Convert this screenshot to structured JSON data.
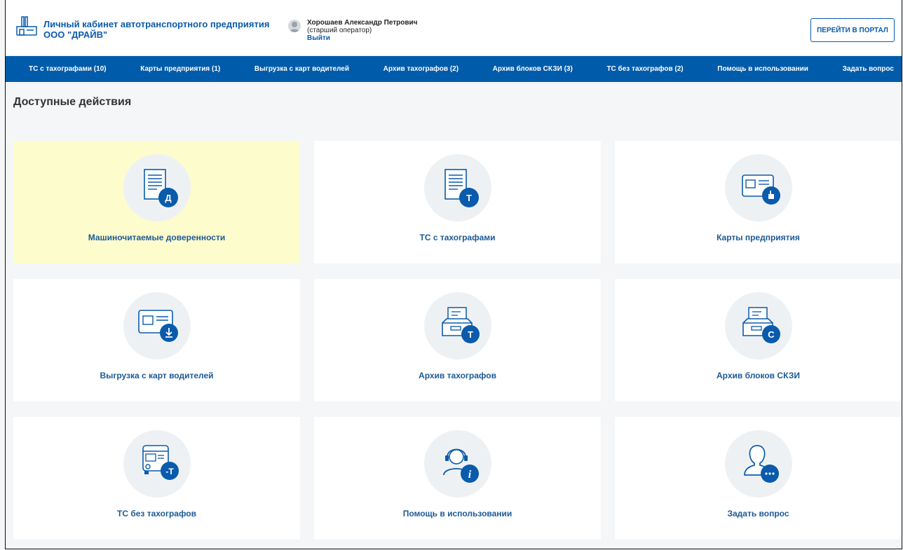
{
  "header": {
    "company_line1": "Личный кабинет автотранспортного предприятия",
    "company_line2": "ООО \"ДРАЙВ\"",
    "user_name": "Хорошаев Александр Петрович",
    "user_role": "(старший оператор)",
    "logout": "Выйти",
    "portal_button": "ПЕРЕЙТИ В ПОРТАЛ"
  },
  "nav": {
    "items": [
      {
        "label": "ТС с тахографами (10)"
      },
      {
        "label": "Карты предприятия (1)"
      },
      {
        "label": "Выгрузка с карт водителей"
      },
      {
        "label": "Архив тахографов (2)"
      },
      {
        "label": "Архив блоков СКЗИ (3)"
      },
      {
        "label": "ТС без тахографов (2)"
      },
      {
        "label": "Помощь в использовании"
      },
      {
        "label": "Задать вопрос"
      }
    ]
  },
  "main": {
    "title": "Доступные действия",
    "cards": [
      {
        "label": "Машиночитаемые доверенности",
        "icon": "document-icon",
        "badge": "Д",
        "highlighted": true
      },
      {
        "label": "ТС с тахографами",
        "icon": "document-icon",
        "badge": "Т"
      },
      {
        "label": "Карты предприятия",
        "icon": "card-icon",
        "badge": "hand"
      },
      {
        "label": "Выгрузка с карт водителей",
        "icon": "card-icon",
        "badge": "download"
      },
      {
        "label": "Архив тахографов",
        "icon": "archive-icon",
        "badge": "Т"
      },
      {
        "label": "Архив блоков СКЗИ",
        "icon": "archive-icon",
        "badge": "С"
      },
      {
        "label": "ТС без тахографов",
        "icon": "truck-icon",
        "badge": "-Т"
      },
      {
        "label": "Помощь в использовании",
        "icon": "headset-icon",
        "badge": "i"
      },
      {
        "label": "Задать вопрос",
        "icon": "user-question-icon",
        "badge": "..."
      }
    ]
  },
  "colors": {
    "brand": "#005baa",
    "link": "#0a5bab",
    "highlight": "#fdfccd",
    "badge": "#0a5bab"
  }
}
